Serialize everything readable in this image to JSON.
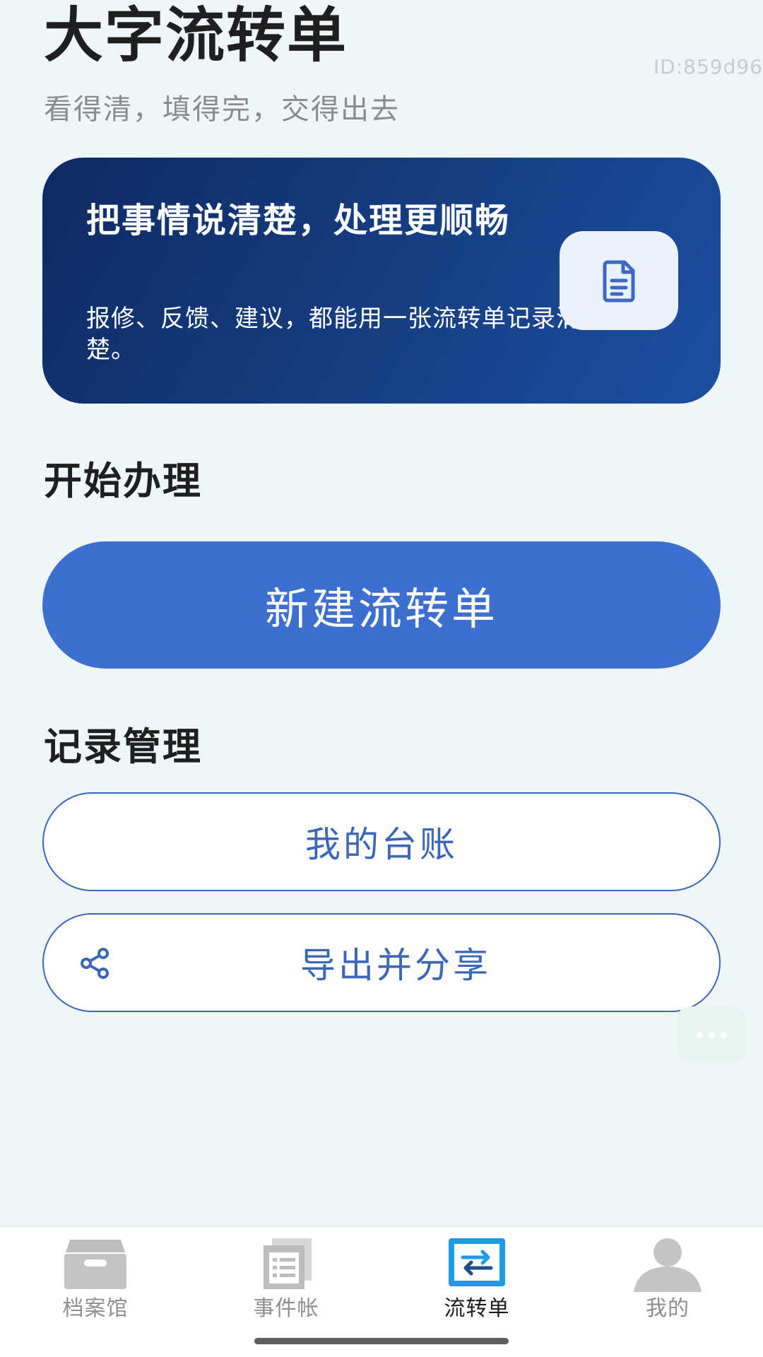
{
  "header": {
    "title": "大字流转单",
    "id_label": "ID:859d96",
    "subtitle": "看得清，填得完，交得出去"
  },
  "hero": {
    "title": "把事情说清楚，处理更顺畅",
    "text": "报修、反馈、建议，都能用一张流转单记录清楚。",
    "icon": "document-icon"
  },
  "sections": {
    "start": {
      "title": "开始办理",
      "new_button": "新建流转单"
    },
    "records": {
      "title": "记录管理",
      "ledger_button": "我的台账",
      "export_button": "导出并分享",
      "export_icon": "share-icon"
    }
  },
  "fab": {
    "icon": "more-icon"
  },
  "tabs": [
    {
      "label": "档案馆",
      "icon": "archive-box-icon",
      "active": false
    },
    {
      "label": "事件帐",
      "icon": "list-document-icon",
      "active": false
    },
    {
      "label": "流转单",
      "icon": "swap-arrows-icon",
      "active": true
    },
    {
      "label": "我的",
      "icon": "user-icon",
      "active": false
    }
  ],
  "colors": {
    "primary": "#3d6fd2",
    "outline": "#3b67b8",
    "hero_dark": "#0e2a64",
    "background": "#eef6fa",
    "active_tab": "#1f9be6",
    "inactive_tab": "#bcbcbc"
  }
}
